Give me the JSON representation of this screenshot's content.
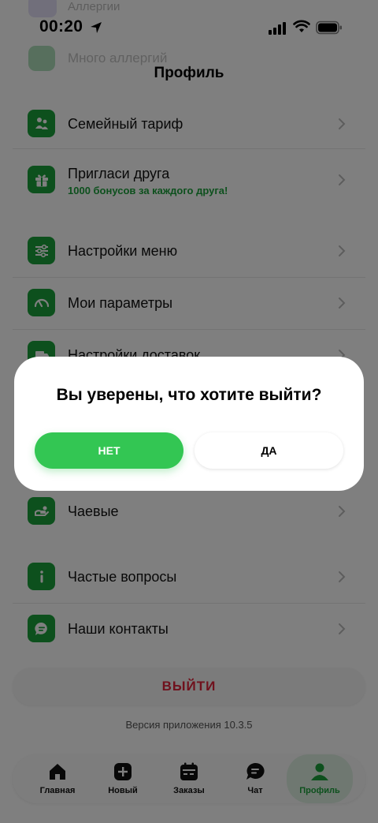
{
  "status_bar": {
    "time": "00:20",
    "behind_label": "Аллергии"
  },
  "behind_item": {
    "label": "Много аллергий"
  },
  "page": {
    "title": "Профиль"
  },
  "menu": [
    {
      "label": "Семейный тариф",
      "icon": "family-icon"
    },
    {
      "label": "Пригласи друга",
      "sub": "1000 бонусов за каждого друга!",
      "icon": "gift-icon"
    },
    {
      "label": "Настройки меню",
      "icon": "sliders-icon"
    },
    {
      "label": "Мои параметры",
      "icon": "gauge-icon"
    },
    {
      "label": "Настройки доставок",
      "icon": "delivery-icon"
    },
    {
      "label": "Чаевые",
      "icon": "tips-icon"
    },
    {
      "label": "Частые вопросы",
      "icon": "info-icon"
    },
    {
      "label": "Наши контакты",
      "icon": "chat-bubble-icon"
    }
  ],
  "logout": {
    "label": "ВЫЙТИ"
  },
  "version": "Версия приложения 10.3.5",
  "tabs": [
    {
      "label": "Главная",
      "icon": "home-icon"
    },
    {
      "label": "Новый",
      "icon": "plus-icon"
    },
    {
      "label": "Заказы",
      "icon": "calendar-icon"
    },
    {
      "label": "Чат",
      "icon": "chat-icon"
    },
    {
      "label": "Профиль",
      "icon": "person-icon",
      "active": true
    }
  ],
  "dialog": {
    "title": "Вы уверены, что хотите выйти?",
    "no_label": "НЕТ",
    "yes_label": "ДА"
  },
  "colors": {
    "accent": "#1aa13a",
    "button_green": "#33c653",
    "danger": "#e0233a"
  }
}
